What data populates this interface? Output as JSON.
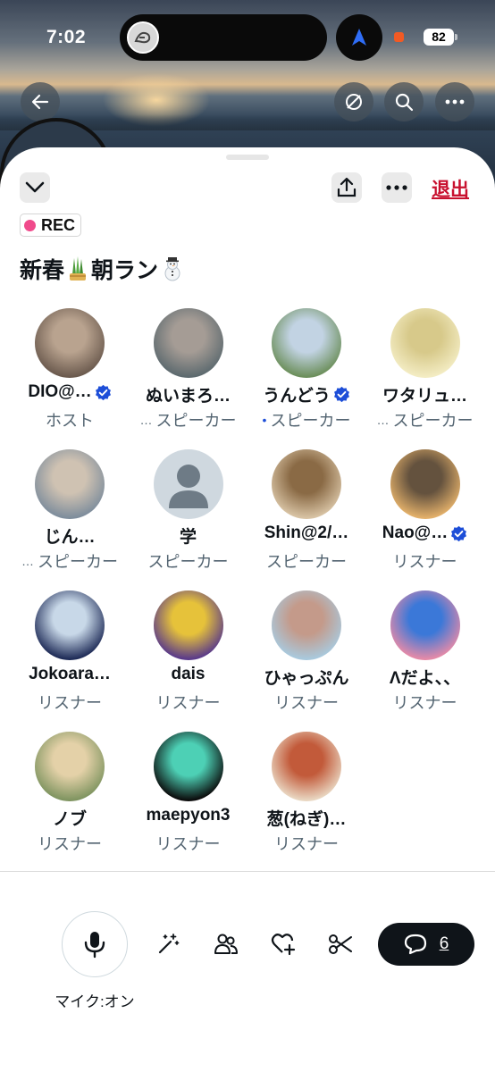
{
  "status_bar": {
    "time": "7:02",
    "battery": "82"
  },
  "header": {
    "leave_label": "退出"
  },
  "space": {
    "rec_label": "REC",
    "title_part1": "新春",
    "title_part2": "朝ラン"
  },
  "participants": [
    {
      "name": "DIO@…",
      "role": "ホスト",
      "verified": true,
      "role_prefix": "",
      "avatar_colors": [
        "#6b5a4e",
        "#b9a38f"
      ]
    },
    {
      "name": "ぬいまろ…",
      "role": "スピーカー",
      "verified": false,
      "role_prefix": "…",
      "avatar_colors": [
        "#5d6a6f",
        "#a59c95"
      ]
    },
    {
      "name": "うんどう",
      "role": "スピーカー",
      "verified": true,
      "role_prefix": "•",
      "avatar_colors": [
        "#6c8f5b",
        "#c2d3e3"
      ]
    },
    {
      "name": "ワタリュ…",
      "role": "スピーカー",
      "verified": false,
      "role_prefix": "…",
      "avatar_colors": [
        "#f3ecc3",
        "#d7c98a"
      ]
    },
    {
      "name": "じん…",
      "role": "スピーカー",
      "verified": false,
      "role_prefix": "…",
      "avatar_colors": [
        "#7e8d9c",
        "#cfc2b2"
      ]
    },
    {
      "name": "学",
      "role": "スピーカー",
      "verified": false,
      "role_prefix": "",
      "avatar_colors": [
        "#cfd8df",
        "#cfd8df"
      ]
    },
    {
      "name": "Shin@2/…",
      "role": "スピーカー",
      "verified": false,
      "role_prefix": "",
      "avatar_colors": [
        "#d8c3a4",
        "#8a6a45"
      ]
    },
    {
      "name": "Nao@…",
      "role": "リスナー",
      "verified": true,
      "role_prefix": "",
      "avatar_colors": [
        "#e3b06a",
        "#64523e"
      ]
    },
    {
      "name": "Jokoara…",
      "role": "リスナー",
      "verified": false,
      "role_prefix": "",
      "avatar_colors": [
        "#1e2b57",
        "#c8d8e8"
      ]
    },
    {
      "name": "dais",
      "role": "リスナー",
      "verified": false,
      "role_prefix": "",
      "avatar_colors": [
        "#5a3a8a",
        "#e6c23a"
      ]
    },
    {
      "name": "ひゃっぷん",
      "role": "リスナー",
      "verified": false,
      "role_prefix": "",
      "avatar_colors": [
        "#a9c9dd",
        "#c49a8a"
      ]
    },
    {
      "name": "Λだよ、、",
      "role": "リスナー",
      "verified": false,
      "role_prefix": "",
      "avatar_colors": [
        "#e58aa8",
        "#3b78d8"
      ]
    },
    {
      "name": "ノブ",
      "role": "リスナー",
      "verified": false,
      "role_prefix": "",
      "avatar_colors": [
        "#7f9460",
        "#e4d1a8"
      ]
    },
    {
      "name": "maepyon3",
      "role": "リスナー",
      "verified": false,
      "role_prefix": "",
      "avatar_colors": [
        "#0b0b0b",
        "#4dd0b5"
      ]
    },
    {
      "name": "葱(ねぎ)…",
      "role": "リスナー",
      "verified": false,
      "role_prefix": "",
      "avatar_colors": [
        "#e9d7c2",
        "#c25a3a"
      ]
    }
  ],
  "bottom_bar": {
    "mic_label": "マイク:オン",
    "comments_count": "6"
  }
}
